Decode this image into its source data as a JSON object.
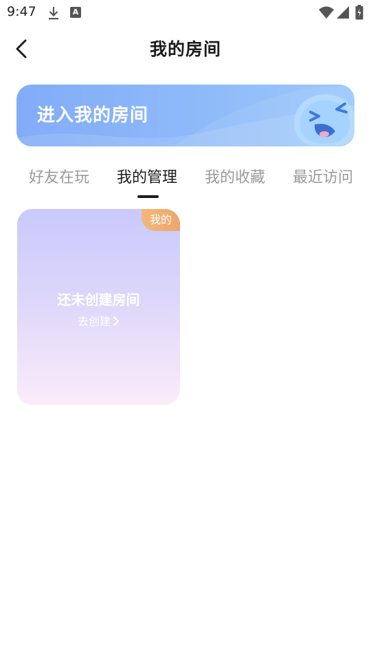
{
  "status_bar": {
    "time": "9:47",
    "icons": [
      "download-icon",
      "a-icon",
      "wifi-icon",
      "signal-icon",
      "battery-icon"
    ],
    "a_glyph": "A"
  },
  "header": {
    "title": "我的房间",
    "back_icon": "chevron-left-icon"
  },
  "banner": {
    "text": "进入我的房间",
    "mascot": "laughing-blob-mascot",
    "colors": {
      "start": "#82acf8",
      "end": "#9cc9fb"
    }
  },
  "tabs": [
    {
      "label": "好友在玩",
      "active": false
    },
    {
      "label": "我的管理",
      "active": true
    },
    {
      "label": "我的收藏",
      "active": false
    },
    {
      "label": "最近访问",
      "active": false
    }
  ],
  "room_card": {
    "badge": "我的",
    "empty_title": "还未创建房间",
    "create_link": "去创建",
    "colors": {
      "top": "#c9c9fd",
      "bottom": "#fcecfa",
      "badge": "#f0aa6e"
    }
  }
}
